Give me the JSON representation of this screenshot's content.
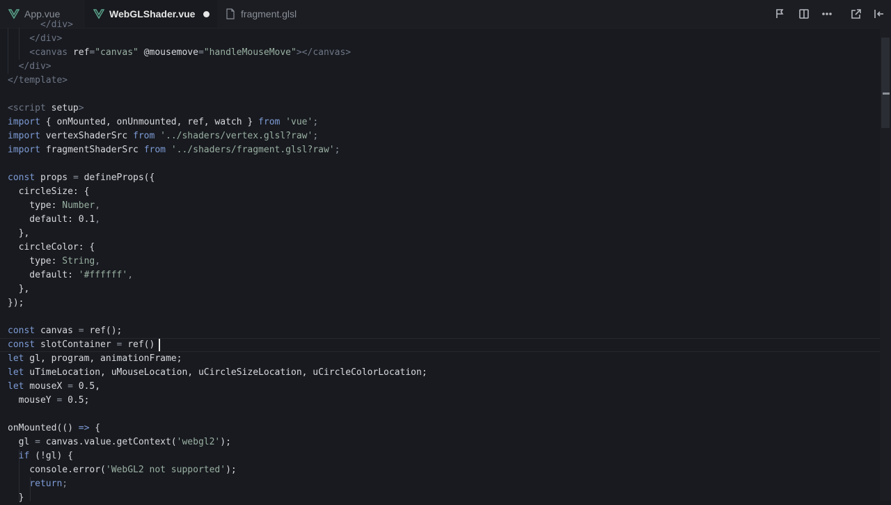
{
  "tabs": [
    {
      "label": "App.vue",
      "icon": "vue-icon",
      "active": false
    },
    {
      "label": "WebGLShader.vue",
      "icon": "vue-icon",
      "active": true,
      "modified": true
    },
    {
      "label": "fragment.glsl",
      "icon": "file-icon",
      "active": false
    }
  ],
  "toolbar_icons": [
    "open-changes-icon",
    "split-editor-icon",
    "more-actions-icon",
    "open-external-icon",
    "toggle-panel-icon"
  ],
  "colors": {
    "background": "#181a1f",
    "keyword": "#7e9bd6",
    "string": "#9ab0a2",
    "tag": "#6e7686",
    "text": "#d7dae0"
  },
  "code_lines": [
    [
      [
        "      ",
        "id"
      ],
      [
        "</div>",
        "tag"
      ]
    ],
    [
      [
        "    </div>",
        "tag"
      ]
    ],
    [
      [
        "    <canvas ",
        "tag"
      ],
      [
        "ref",
        "id"
      ],
      [
        "=",
        "punc"
      ],
      [
        "\"canvas\"",
        "str"
      ],
      [
        " @mousemove",
        "id"
      ],
      [
        "=",
        "punc"
      ],
      [
        "\"handleMouseMove\"",
        "str"
      ],
      [
        "></canvas>",
        "tag"
      ]
    ],
    [
      [
        "  </div>",
        "tag"
      ]
    ],
    [
      [
        "</template>",
        "tag"
      ]
    ],
    [
      [
        "",
        "id"
      ]
    ],
    [
      [
        "<script ",
        "tag"
      ],
      [
        "setup",
        "id"
      ],
      [
        ">",
        "tag"
      ]
    ],
    [
      [
        "import",
        "kw"
      ],
      [
        " { onMounted, onUnmounted, ref, watch } ",
        "id"
      ],
      [
        "from",
        "kw"
      ],
      [
        " 'vue'",
        "str"
      ],
      [
        ";",
        "punc"
      ]
    ],
    [
      [
        "import",
        "kw"
      ],
      [
        " vertexShaderSrc ",
        "id"
      ],
      [
        "from",
        "kw"
      ],
      [
        " '../shaders/vertex.glsl?raw'",
        "str"
      ],
      [
        ";",
        "punc"
      ]
    ],
    [
      [
        "import",
        "kw"
      ],
      [
        " fragmentShaderSrc ",
        "id"
      ],
      [
        "from",
        "kw"
      ],
      [
        " '../shaders/fragment.glsl?raw'",
        "str"
      ],
      [
        ";",
        "punc"
      ]
    ],
    [
      [
        "",
        "id"
      ]
    ],
    [
      [
        "const",
        "kw"
      ],
      [
        " props ",
        "id"
      ],
      [
        "=",
        "punc"
      ],
      [
        " defineProps({",
        "id"
      ]
    ],
    [
      [
        "  circleSize: {",
        "id"
      ]
    ],
    [
      [
        "    type: ",
        "id"
      ],
      [
        "Number",
        "str"
      ],
      [
        ",",
        "punc"
      ]
    ],
    [
      [
        "    default: ",
        "id"
      ],
      [
        "0.1",
        "id"
      ],
      [
        ",",
        "punc"
      ]
    ],
    [
      [
        "  },",
        "id"
      ]
    ],
    [
      [
        "  circleColor: {",
        "id"
      ]
    ],
    [
      [
        "    type: ",
        "id"
      ],
      [
        "String",
        "str"
      ],
      [
        ",",
        "punc"
      ]
    ],
    [
      [
        "    default: ",
        "id"
      ],
      [
        "'#ffffff'",
        "str"
      ],
      [
        ",",
        "punc"
      ]
    ],
    [
      [
        "  },",
        "id"
      ]
    ],
    [
      [
        "});",
        "id"
      ]
    ],
    [
      [
        "",
        "id"
      ]
    ],
    [
      [
        "const",
        "kw"
      ],
      [
        " canvas ",
        "id"
      ],
      [
        "=",
        "punc"
      ],
      [
        " ref();",
        "id"
      ]
    ],
    [
      [
        "const",
        "kw"
      ],
      [
        " slotContainer ",
        "id"
      ],
      [
        "=",
        "punc"
      ],
      [
        " ref()",
        "id"
      ]
    ],
    [
      [
        "let",
        "kw"
      ],
      [
        " gl, program, animationFrame;",
        "id"
      ]
    ],
    [
      [
        "let",
        "kw"
      ],
      [
        " uTimeLocation, uMouseLocation, uCircleSizeLocation, uCircleColorLocation;",
        "id"
      ]
    ],
    [
      [
        "let",
        "kw"
      ],
      [
        " mouseX ",
        "id"
      ],
      [
        "=",
        "punc"
      ],
      [
        " 0.5,",
        "id"
      ]
    ],
    [
      [
        "  mouseY ",
        "id"
      ],
      [
        "=",
        "punc"
      ],
      [
        " 0.5;",
        "id"
      ]
    ],
    [
      [
        "",
        "id"
      ]
    ],
    [
      [
        "onMounted(() ",
        "id"
      ],
      [
        "=>",
        "kw"
      ],
      [
        " {",
        "id"
      ]
    ],
    [
      [
        "  gl ",
        "id"
      ],
      [
        "=",
        "punc"
      ],
      [
        " canvas.value.getContext(",
        "id"
      ],
      [
        "'webgl2'",
        "str"
      ],
      [
        ");",
        "id"
      ]
    ],
    [
      [
        "  ",
        "id"
      ],
      [
        "if",
        "kw"
      ],
      [
        " (!gl) {",
        "id"
      ]
    ],
    [
      [
        "    console.error(",
        "id"
      ],
      [
        "'WebGL2 not supported'",
        "str"
      ],
      [
        ");",
        "id"
      ]
    ],
    [
      [
        "    ",
        "id"
      ],
      [
        "return",
        "kw"
      ],
      [
        ";",
        "punc"
      ]
    ],
    [
      [
        "  }",
        "id"
      ]
    ]
  ]
}
